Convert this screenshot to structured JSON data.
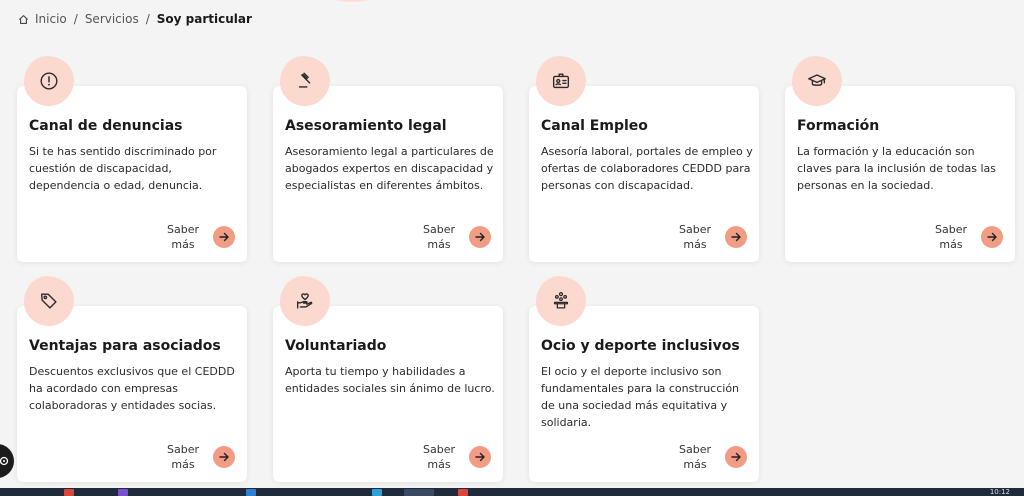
{
  "breadcrumb": {
    "home_icon": "home-icon",
    "items": [
      "Inicio",
      "Servicios",
      "Soy particular"
    ],
    "separator": "/"
  },
  "accent_color": "#f29c86",
  "badge_color": "#fcd9cf",
  "cards": [
    {
      "icon": "alert-circle-icon",
      "title": "Canal de denuncias",
      "description": "Si te has sentido discriminado por cuestión de discapacidad, dependencia o edad, denuncia.",
      "more_label": "Saber más"
    },
    {
      "icon": "gavel-icon",
      "title": "Asesoramiento legal",
      "description": "Asesoramiento legal a particulares de abogados expertos en discapacidad y especialistas en diferentes ámbitos.",
      "more_label": "Saber más"
    },
    {
      "icon": "id-card-icon",
      "title": "Canal Empleo",
      "description": "Asesoría laboral, portales de empleo y ofertas de colaboradores CEDDD para personas con discapacidad.",
      "more_label": "Saber más"
    },
    {
      "icon": "graduation-cap-icon",
      "title": "Formación",
      "description": "La formación y la educación son claves para la inclusión de todas las personas en la sociedad.",
      "more_label": "Saber más"
    },
    {
      "icon": "tag-icon",
      "title": "Ventajas para asociados",
      "description": "Descuentos exclusivos que el CEDDD ha acordado con empresas colaboradoras y entidades socias.",
      "more_label": "Saber más"
    },
    {
      "icon": "heart-hand-icon",
      "title": "Voluntariado",
      "description": "Aporta tu tiempo y habilidades a entidades sociales sin ánimo de lucro.",
      "more_label": "Saber más"
    },
    {
      "icon": "team-podium-icon",
      "title": "Ocio y deporte inclusivos",
      "description": "El ocio y el deporte inclusivo son fundamentales para la construcción de una sociedad más equitativa y solidaria.",
      "more_label": "Saber más"
    }
  ],
  "taskbar": {
    "clock": "10:12"
  }
}
